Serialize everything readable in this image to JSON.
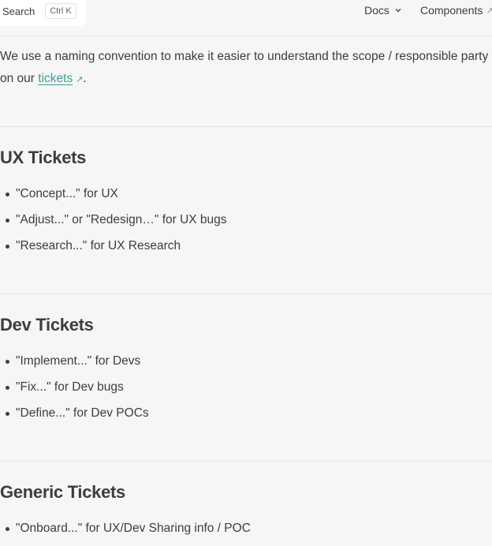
{
  "header": {
    "search_label": "Search",
    "search_shortcut": "Ctrl K",
    "nav_docs": "Docs",
    "nav_components": "Components",
    "external_glyph": "↗"
  },
  "intro": {
    "text_before": "We use a naming convention to make it easier to understand the scope / responsible party on our ",
    "link_text": "tickets",
    "text_after": "."
  },
  "sections": [
    {
      "title": "UX Tickets",
      "items": [
        "\"Concept...\" for UX",
        "\"Adjust...\" or \"Redesign…\" for UX bugs",
        "\"Research...\" for UX Research"
      ]
    },
    {
      "title": "Dev Tickets",
      "items": [
        "\"Implement...\" for Devs",
        "\"Fix...\" for Dev bugs",
        "\"Define...\" for Dev POCs"
      ]
    },
    {
      "title": "Generic Tickets",
      "items": [
        "\"Onboard...\" for UX/Dev Sharing info / POC"
      ]
    }
  ],
  "colors": {
    "background": "#f6f6f7",
    "text": "#3c3c43",
    "link": "#3a9e92",
    "divider": "#e2e2e3"
  },
  "icons": {
    "docs_dropdown": "chevron-down-icon",
    "external": "external-link-icon"
  }
}
